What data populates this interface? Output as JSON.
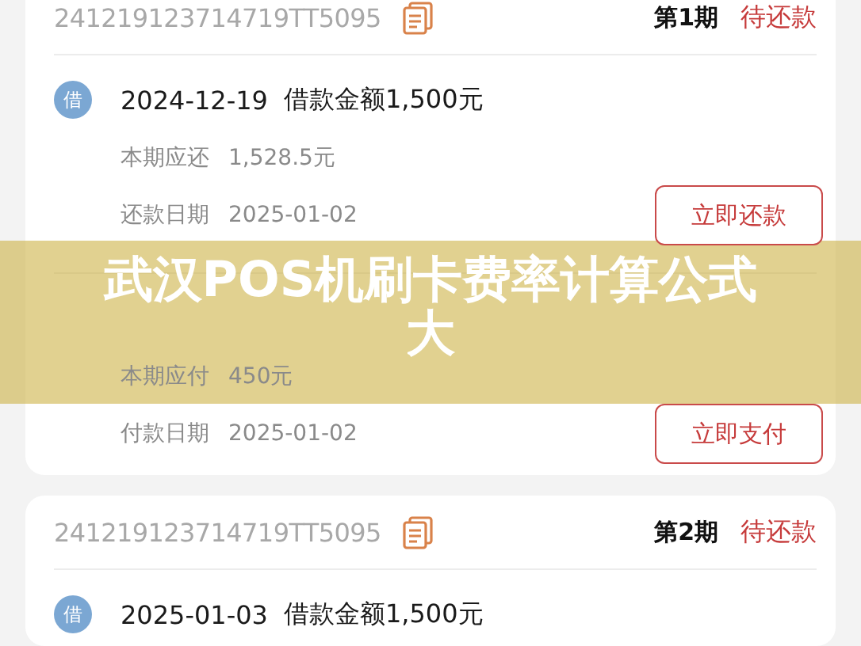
{
  "cards": [
    {
      "order_no": "241219123714719TT5095",
      "period": "第1期",
      "status": "待还款",
      "entries": [
        {
          "badge": "借",
          "color": "#7ba7d3",
          "date": "2024-12-19",
          "summary": "借款金额1,500元",
          "rows": [
            {
              "label": "本期应还",
              "value": "1,528.5元"
            },
            {
              "label": "还款日期",
              "value": "2025-01-02"
            }
          ],
          "button": "立即还款"
        },
        {
          "rows": [
            {
              "label": "本期应付",
              "value": "450元"
            },
            {
              "label": "付款日期",
              "value": "2025-01-02"
            }
          ],
          "button": "立即支付"
        }
      ]
    },
    {
      "order_no": "241219123714719TT5095",
      "period": "第2期",
      "status": "待还款",
      "entries": [
        {
          "badge": "借",
          "color": "#7ba7d3",
          "date": "2025-01-03",
          "summary": "借款金额1,500元"
        }
      ]
    }
  ],
  "overlay_title": "武汉POS机刷卡费率计算公式大"
}
